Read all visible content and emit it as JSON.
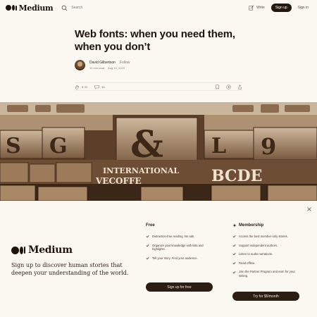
{
  "nav": {
    "logo_text": "Medium",
    "search_placeholder": "Search",
    "write_label": "Write",
    "signup_label": "Sign up",
    "signin_label": "Sign in"
  },
  "article": {
    "title": "Web fonts: when you need them, when you don’t",
    "author": "David Gilbertson",
    "follow_label": "Follow",
    "read_time": "10 min read",
    "date": "Aug 12, 2019",
    "claps": "5.7K",
    "responses": "46"
  },
  "hero": {
    "sign_text_1": "INTERNATIONAL",
    "sign_text_2": "VECOFFE",
    "sign_text_3": "BCDE"
  },
  "overlay": {
    "close_glyph": "×",
    "logo_text": "Medium",
    "tagline": "Sign up to discover human stories that deepen your understanding of the world.",
    "free": {
      "title": "Free",
      "items": [
        "Distraction-free reading. No ads.",
        "Organize your knowledge with lists and highlights.",
        "Tell your story. Find your audience."
      ],
      "button": "Sign up for free"
    },
    "membership": {
      "title": "Membership",
      "items": [
        "Access the best member-only stories.",
        "Support independent authors.",
        "Listen to audio narrations.",
        "Read offline.",
        "Join the Partner Program and earn for your writing."
      ],
      "button": "Try for $5/month"
    }
  },
  "colors": {
    "background": "#fbf8f2",
    "text": "#2a1d12",
    "button": "#2d1e13"
  }
}
